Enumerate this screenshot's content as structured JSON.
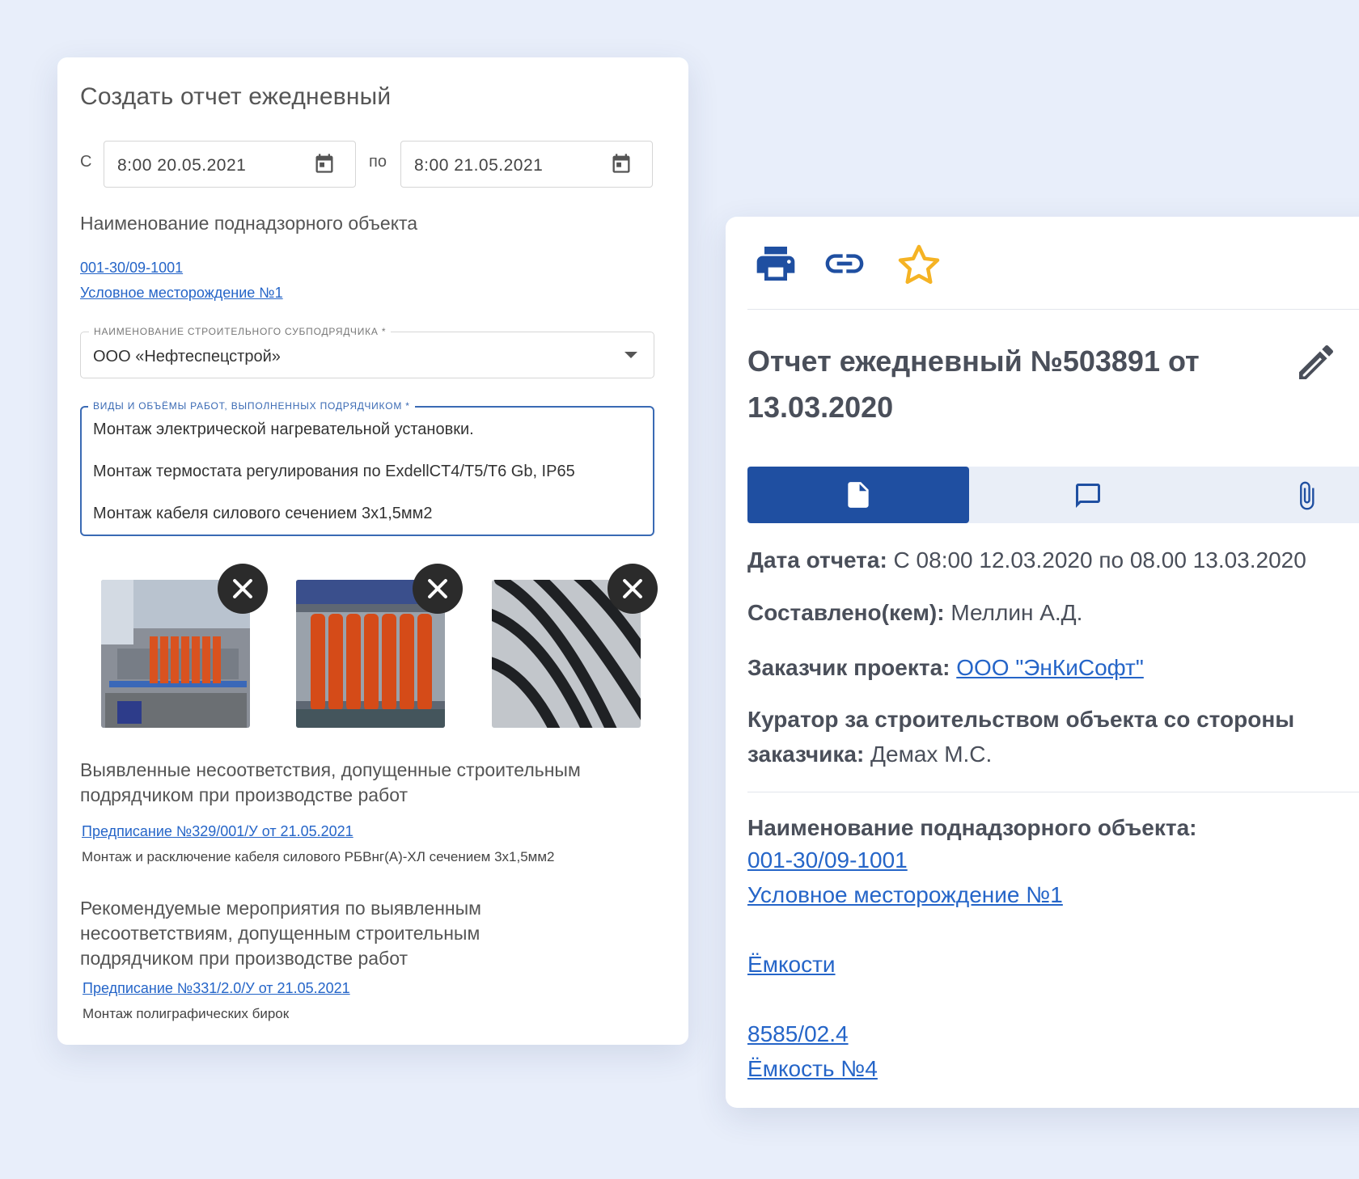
{
  "left": {
    "title": "Создать отчет ежедневный",
    "from_label": "С",
    "to_label": "по",
    "date_from": "8:00 20.05.2021",
    "date_to": "8:00 21.05.2021",
    "object_title": "Наименование поднадзорного объекта",
    "object_code": "001-30/09-1001",
    "object_name": "Условное месторождение №1",
    "subcontractor_legend": "Наименование строительного субподрядчика *",
    "subcontractor_value": "ООО «Нефтеспецстрой»",
    "works_legend": "Виды и объёмы работ, выполненных подрядчиком *",
    "works_lines": [
      "Монтаж электрической нагревательной установки.",
      "Монтаж термостата регулирования по ExdellCT4/T5/T6 Gb, IP65",
      "Монтаж кабеля силового сечением 3х1,5мм2"
    ],
    "issues_title_1": "Выявленные несоответствия, допущенные строительным",
    "issues_title_2": "подрядчиком при производстве работ",
    "issue_link": "Предписание №329/001/У от 21.05.2021",
    "issue_text": "Монтаж и расключение кабеля силового РБВнг(А)-ХЛ сечением 3х1,5мм2",
    "rec_title_1": "Рекомендуемые мероприятия по выявленным",
    "rec_title_2": "несоответствиям, допущенным строительным",
    "rec_title_3": "подрядчиком при производстве работ",
    "rec_link": "Предписание №331/2.0/У от 21.05.2021",
    "rec_text": "Монтаж полиграфических бирок"
  },
  "right": {
    "title": "Отчет ежедневный №503891 от 13.03.2020",
    "date_label": "Дата отчета:",
    "date_value": " С 08:00 12.03.2020 по 08.00 13.03.2020",
    "author_label": "Составлено(кем):",
    "author_value": " Меллин А.Д.",
    "customer_label": "Заказчик проекта:",
    "customer_value": "ООО \"ЭнКиСофт\"",
    "curator_label_1": "Куратор за строительством объекта со стороны",
    "curator_label_2": "заказчика:",
    "curator_value": " Демах М.С.",
    "object_label": "Наименование поднадзорного объекта:",
    "object_code": "001-30/09-1001",
    "object_name": "Условное месторождение №1",
    "tanks_link": "Ёмкости",
    "tank_code": "8585/02.4",
    "tank_name": "Ёмкость №4"
  },
  "colors": {
    "accent": "#1f4fa1",
    "link": "#2565c8",
    "star": "#f5b324"
  }
}
